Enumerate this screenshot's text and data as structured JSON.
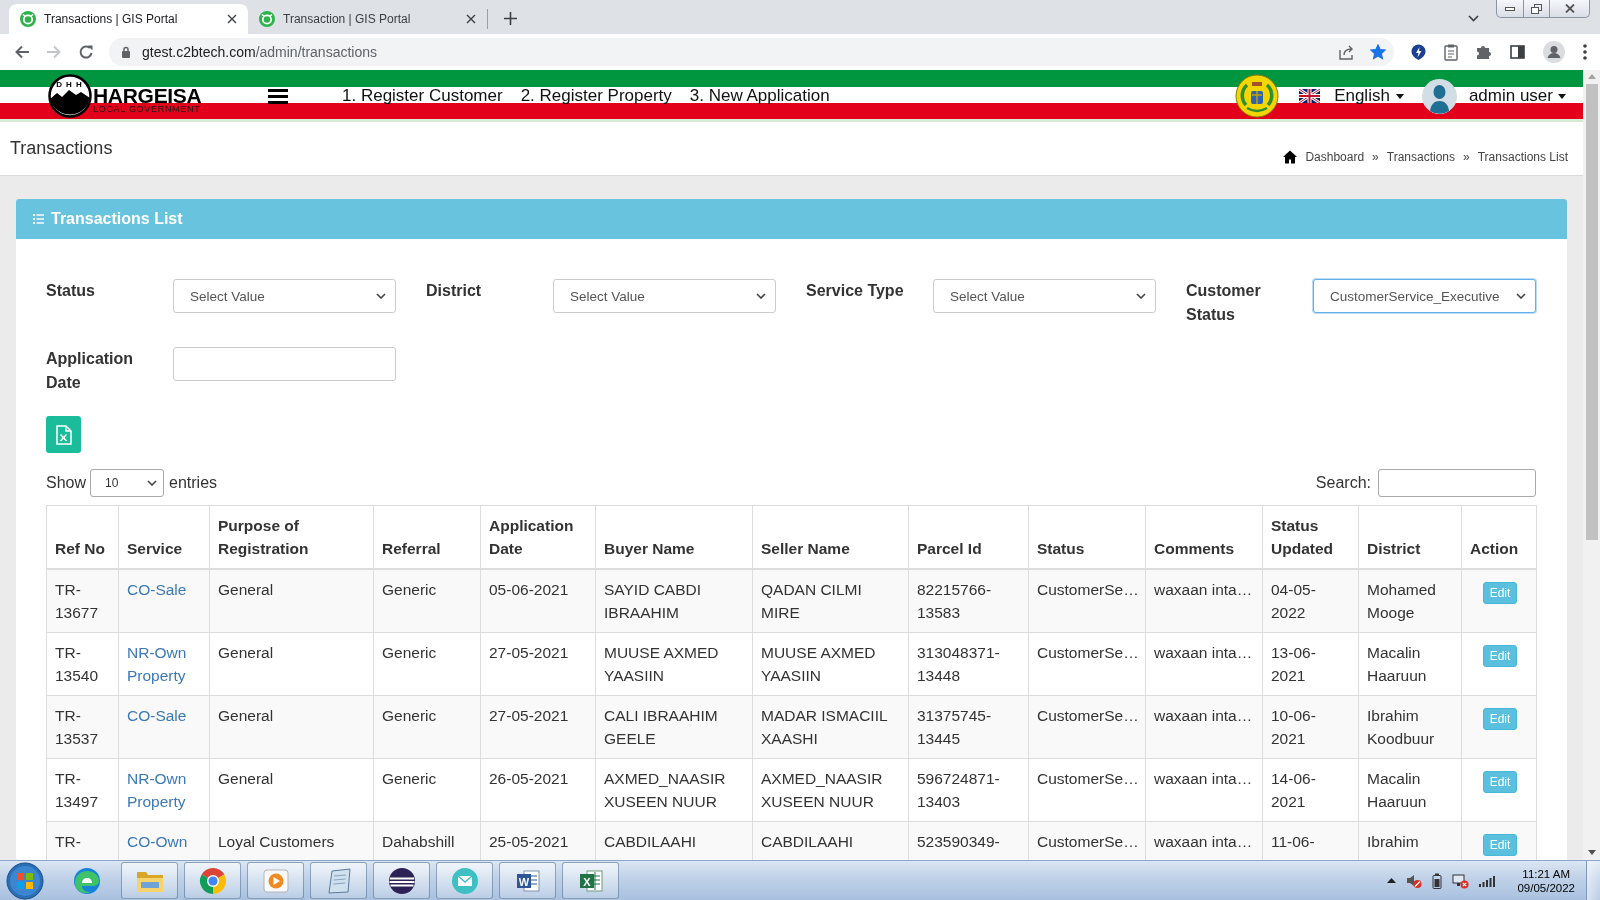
{
  "browser": {
    "tabs": [
      {
        "title": "Transactions | GIS Portal",
        "selected": true
      },
      {
        "title": "Transaction | GIS Portal",
        "selected": false
      }
    ],
    "address": {
      "host": "gtest.c2btech.com",
      "path": "/admin/transactions"
    },
    "forward_disabled": true,
    "bookmarked": true
  },
  "header": {
    "logo": {
      "letters": "DHH",
      "name": "HARGEISA",
      "subtitle": "LOCAL GOVERNMENT"
    },
    "nav": [
      "1. Register Customer",
      "2. Register Property",
      "3. New Application"
    ],
    "language": "English",
    "user": "admin user"
  },
  "page": {
    "title": "Transactions",
    "breadcrumb": [
      {
        "label": "Dashboard",
        "separator": "»"
      },
      {
        "label": "Transactions",
        "separator": "»"
      },
      {
        "label": "Transactions List"
      }
    ]
  },
  "card": {
    "title": "Transactions List",
    "filters": [
      {
        "label": "Status",
        "kind": "select",
        "value": "Select Value",
        "focused": false
      },
      {
        "label": "District",
        "kind": "select",
        "value": "Select Value",
        "focused": false
      },
      {
        "label": "Service Type",
        "kind": "select",
        "value": "Select Value",
        "focused": false
      },
      {
        "label": "Customer Status",
        "kind": "select",
        "value": "CustomerService_Executive",
        "focused": true
      },
      {
        "label": "Application Date",
        "kind": "date",
        "focused": false
      }
    ],
    "length": {
      "before": "Show",
      "value": "10",
      "after": "entries"
    },
    "search": {
      "label": "Search:"
    }
  },
  "table": {
    "columns": [
      "Ref No",
      "Service",
      "Purpose of Registration",
      "Referral",
      "Application Date",
      "Buyer Name",
      "Seller Name",
      "Parcel Id",
      "Status",
      "Comments",
      "Status Updated",
      "District",
      "Action"
    ],
    "rows": [
      {
        "ref_no": "TR-13677",
        "service": "CO-Sale",
        "purpose": "General",
        "referral": "Generic",
        "application_date": "05-06-2021",
        "buyer_name": "SAYID CABDI IBRAAHIM",
        "seller_name": "QADAN CILMI MIRE",
        "parcel_id": "82215766-13583",
        "status": "CustomerSe…",
        "comments": "waxaan inta…",
        "status_updated": "04-05-2022",
        "district": "Mohamed Mooge",
        "action": "Edit"
      },
      {
        "ref_no": "TR-13540",
        "service": "NR-Own Property",
        "purpose": "General",
        "referral": "Generic",
        "application_date": "27-05-2021",
        "buyer_name": "MUUSE AXMED YAASIIN",
        "seller_name": "MUUSE AXMED YAASIIN",
        "parcel_id": "313048371-13448",
        "status": "CustomerSe…",
        "comments": "waxaan inta…",
        "status_updated": "13-06-2021",
        "district": "Macalin Haaruun",
        "action": "Edit"
      },
      {
        "ref_no": "TR-13537",
        "service": "CO-Sale",
        "purpose": "General",
        "referral": "Generic",
        "application_date": "27-05-2021",
        "buyer_name": "CALI IBRAAHIM GEELE",
        "seller_name": "MADAR ISMACIIL XAASHI",
        "parcel_id": "31375745-13445",
        "status": "CustomerSe…",
        "comments": "waxaan inta…",
        "status_updated": "10-06-2021",
        "district": "Ibrahim Koodbuur",
        "action": "Edit"
      },
      {
        "ref_no": "TR-13497",
        "service": "NR-Own Property",
        "purpose": "General",
        "referral": "Generic",
        "application_date": "26-05-2021",
        "buyer_name": "AXMED_NAASIR XUSEEN NUUR",
        "seller_name": "AXMED_NAASIR XUSEEN NUUR",
        "parcel_id": "596724871-13403",
        "status": "CustomerSe…",
        "comments": "waxaan inta…",
        "status_updated": "14-06-2021",
        "district": "Macalin Haaruun",
        "action": "Edit"
      },
      {
        "ref_no": "TR-",
        "service": "CO-Own",
        "purpose": "Loyal Customers",
        "referral": "Dahabshill",
        "application_date": "25-05-2021",
        "buyer_name": "CABDILAAHI",
        "seller_name": "CABDILAAHI",
        "parcel_id": "523590349-",
        "status": "CustomerSe…",
        "comments": "waxaan inta…",
        "status_updated": "11-06-",
        "district": "Ibrahim",
        "action": "Edit"
      }
    ]
  },
  "taskbar": {
    "apps": [
      {
        "kind": "edge",
        "running": false
      },
      {
        "kind": "explorer",
        "running": true
      },
      {
        "kind": "chrome",
        "running": true
      },
      {
        "kind": "media",
        "running": true
      },
      {
        "kind": "notes",
        "running": true
      },
      {
        "kind": "eclipse",
        "running": true
      },
      {
        "kind": "mail",
        "running": true
      },
      {
        "kind": "word",
        "running": true,
        "letter": "W"
      },
      {
        "kind": "excel",
        "running": true,
        "letter": "X"
      }
    ],
    "time": "11:21 AM",
    "date": "09/05/2022"
  }
}
